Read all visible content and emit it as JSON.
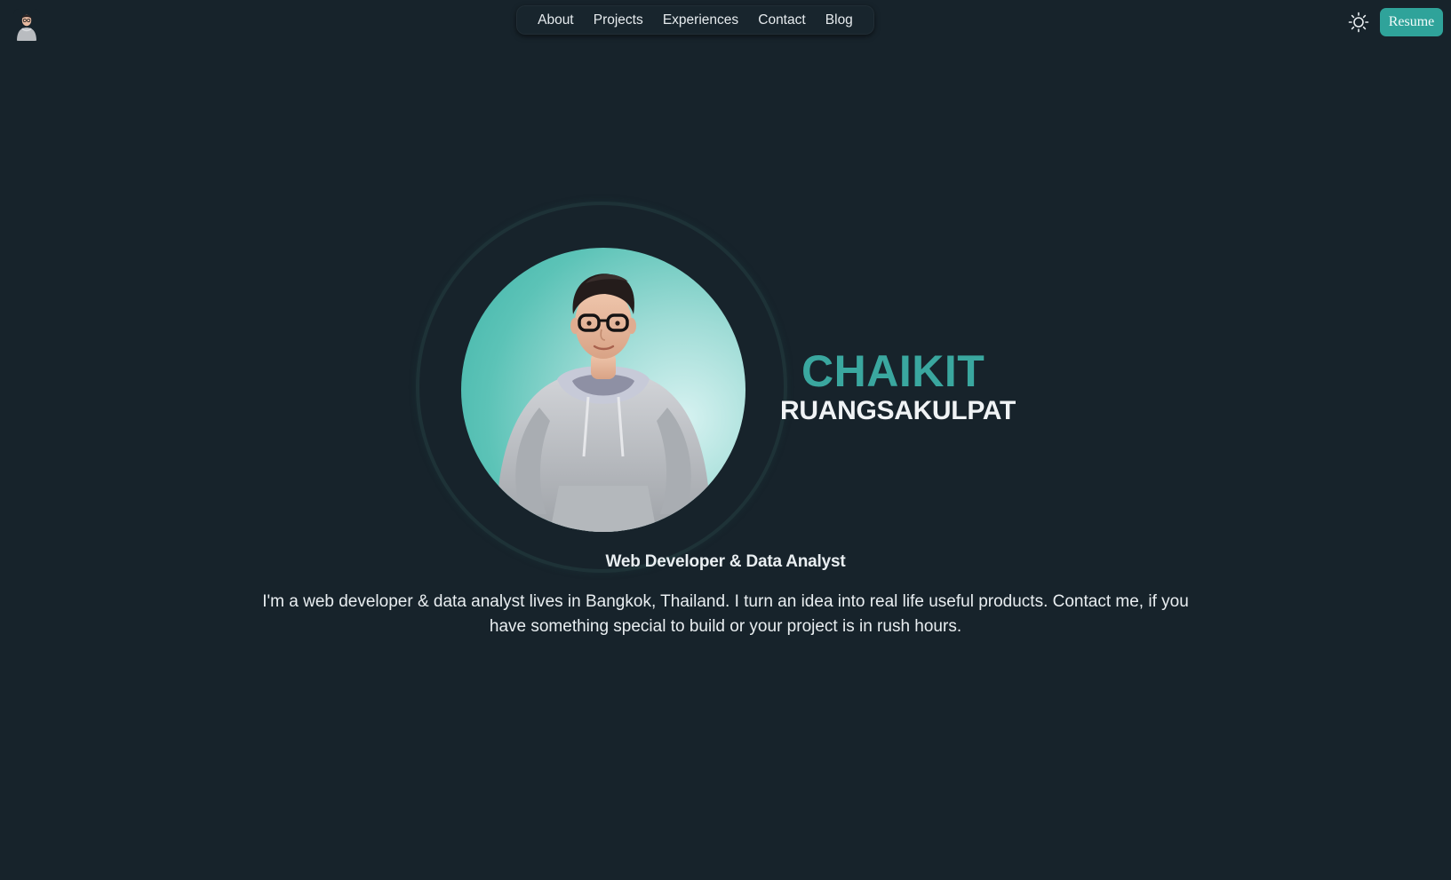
{
  "nav": {
    "items": [
      {
        "label": "About"
      },
      {
        "label": "Projects"
      },
      {
        "label": "Experiences"
      },
      {
        "label": "Contact"
      },
      {
        "label": "Blog"
      }
    ]
  },
  "header": {
    "theme_icon": "sun-icon",
    "resume_label": "Resume",
    "logo_icon": "avatar-logo"
  },
  "hero": {
    "first_name": "CHAIKIT",
    "last_name": "RUANGSAKULPAT",
    "role": "Web Developer & Data Analyst",
    "bio": "I'm a web developer & data analyst lives in Bangkok, Thailand. I turn an idea into real life useful products. Contact me, if you have something special to build or your project is in rush hours."
  },
  "colors": {
    "background": "#17232b",
    "accent": "#3aa79f",
    "button": "#2fa39a",
    "text": "#e9eef1"
  }
}
